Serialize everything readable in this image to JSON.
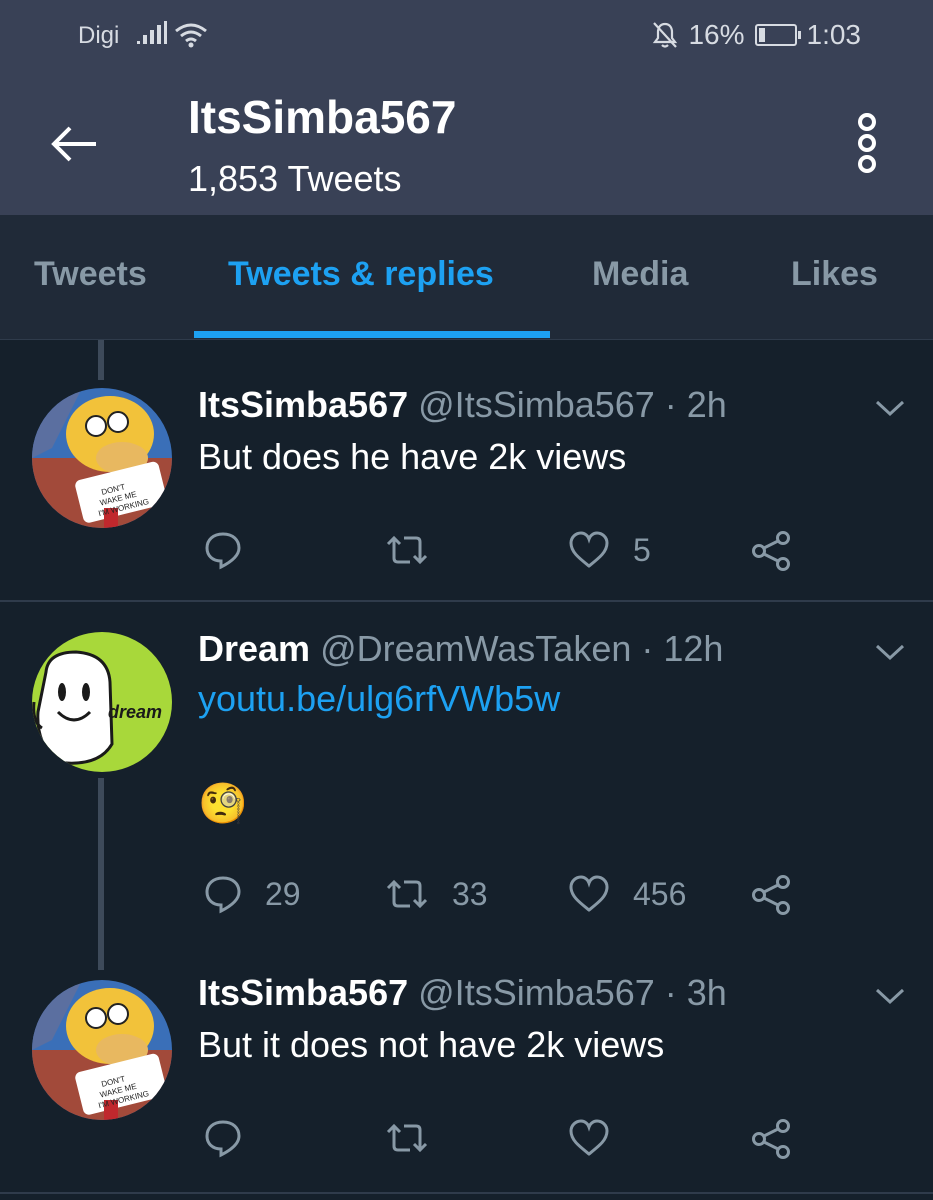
{
  "status_bar": {
    "carrier": "Digi",
    "battery": "16%",
    "time": "1:03"
  },
  "header": {
    "title": "ItsSimba567",
    "subtitle": "1,853 Tweets"
  },
  "tabs": [
    {
      "label": "Tweets",
      "active": false
    },
    {
      "label": "Tweets & replies",
      "active": true
    },
    {
      "label": "Media",
      "active": false
    },
    {
      "label": "Likes",
      "active": false
    }
  ],
  "tweets": [
    {
      "name": "ItsSimba567",
      "handle": "@ItsSimba567 · 2h",
      "text": "But does he have 2k views",
      "avatar_sign": [
        "DON'T",
        "WAKE ME",
        "I'M WORKING"
      ],
      "counts": {
        "reply": "",
        "retweet": "",
        "like": "5"
      }
    },
    {
      "name": "Dream",
      "handle": "@DreamWasTaken · 12h",
      "link": "youtu.be/ulg6rfVWb5w",
      "emoji": "🧐",
      "avatar_label": "dream",
      "counts": {
        "reply": "29",
        "retweet": "33",
        "like": "456"
      }
    },
    {
      "name": "ItsSimba567",
      "handle": "@ItsSimba567 · 3h",
      "text": "But it does not have 2k views",
      "avatar_sign": [
        "DON'T",
        "WAKE ME",
        "I'M WORKING"
      ],
      "counts": {
        "reply": "",
        "retweet": "",
        "like": ""
      }
    }
  ],
  "colors": {
    "background": "#15202b",
    "header": "#394156",
    "accent": "#1da1f2",
    "muted": "#8899a6"
  }
}
